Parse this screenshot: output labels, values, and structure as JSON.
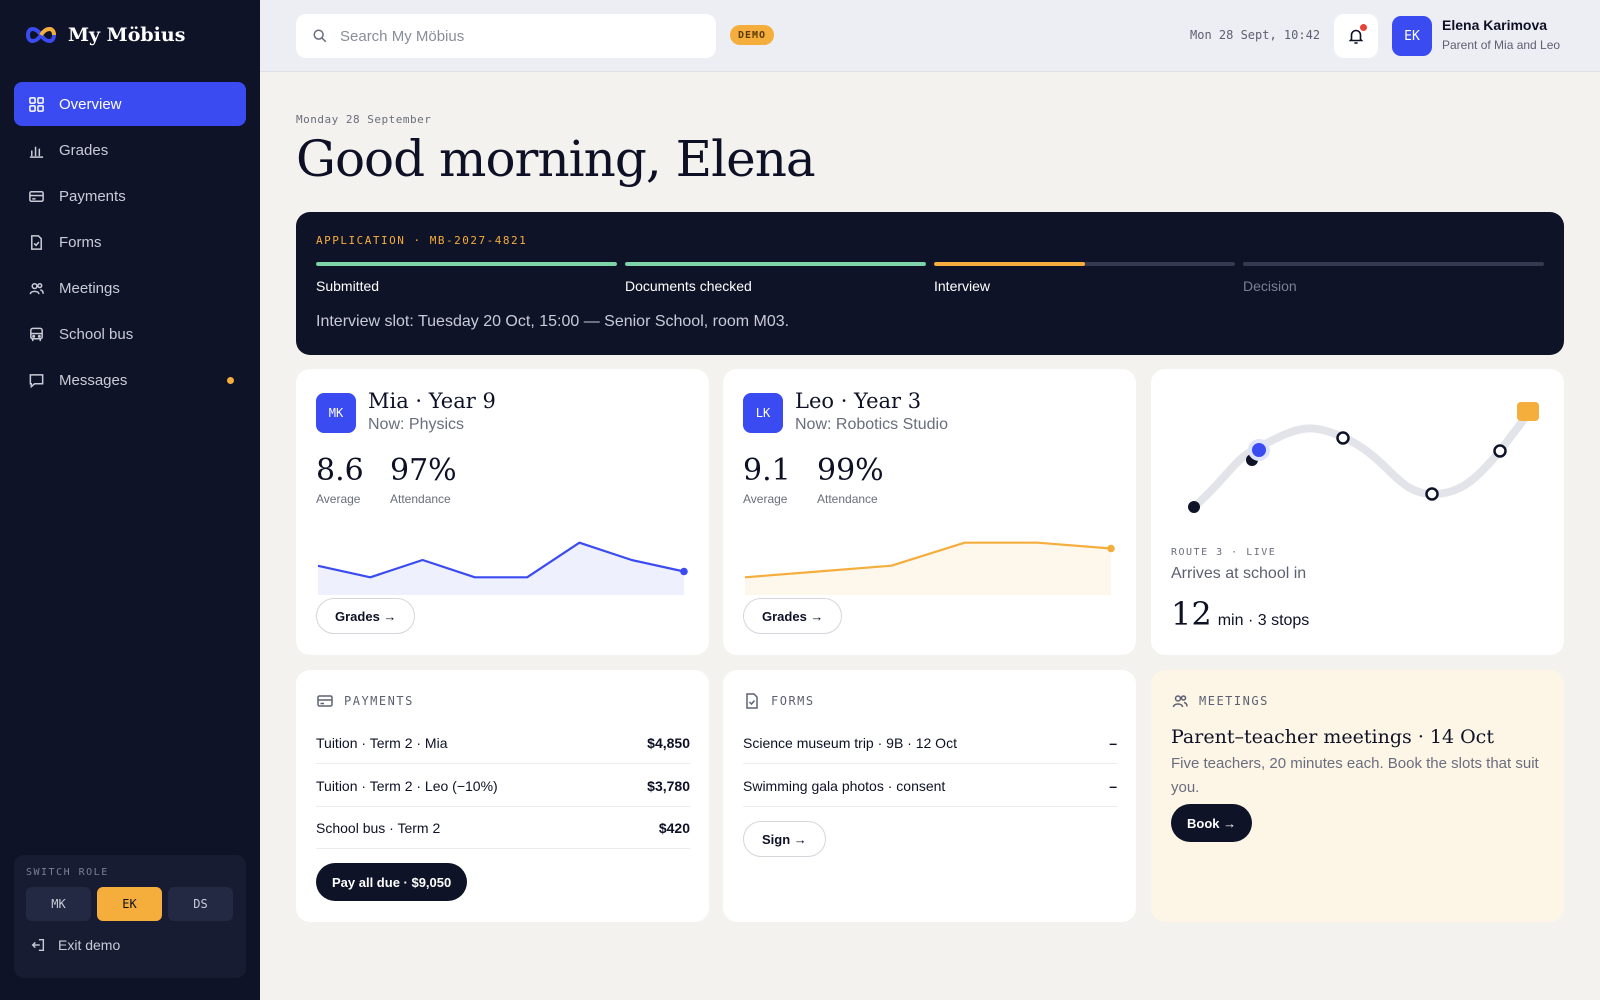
{
  "brand": {
    "name": "My Möbius"
  },
  "sidebar": {
    "items": [
      {
        "label": "Overview",
        "icon": "grid-icon",
        "active": true
      },
      {
        "label": "Grades",
        "icon": "bar-chart-icon"
      },
      {
        "label": "Payments",
        "icon": "card-icon"
      },
      {
        "label": "Forms",
        "icon": "document-check-icon"
      },
      {
        "label": "Meetings",
        "icon": "users-icon"
      },
      {
        "label": "School bus",
        "icon": "bus-icon"
      },
      {
        "label": "Messages",
        "icon": "chat-icon",
        "unread": true
      }
    ],
    "switch_role": {
      "title": "SWITCH ROLE",
      "roles": [
        "MK",
        "EK",
        "DS"
      ],
      "active": "EK"
    },
    "exit_label": "Exit demo"
  },
  "header": {
    "search_placeholder": "Search My Möbius",
    "badge": "DEMO",
    "datetime": "Mon 28 Sept, 10:42",
    "user": {
      "initials": "EK",
      "name": "Elena Karimova",
      "role": "Parent of Mia and Leo"
    }
  },
  "greeting": {
    "date": "Monday 28 September",
    "title": "Good morning, Elena"
  },
  "application": {
    "code": "APPLICATION · MB-2027-4821",
    "steps": [
      {
        "label": "Submitted",
        "progress": 1.0,
        "color": "#7fd3a8"
      },
      {
        "label": "Documents checked",
        "progress": 1.0,
        "color": "#7fd3a8"
      },
      {
        "label": "Interview",
        "progress": 0.5,
        "color": "#f5ad3c"
      },
      {
        "label": "Decision",
        "progress": 0.0,
        "color": "#353a52"
      }
    ],
    "slot": "Interview slot: Tuesday 20 Oct, 15:00 — Senior School, room M03."
  },
  "children": [
    {
      "initials": "MK",
      "name": "Mia · Year 9",
      "now": "Now: Physics",
      "average": "8.6",
      "average_label": "Average",
      "attendance": "97%",
      "attendance_label": "Attendance",
      "button": "Grades →",
      "trend": [
        8.6,
        8.4,
        8.7,
        8.4,
        8.4,
        9.0,
        8.7,
        8.5
      ],
      "color": "#3b4bf2",
      "fill": "#eef0fe"
    },
    {
      "initials": "LK",
      "name": "Leo · Year 3",
      "now": "Now: Robotics Studio",
      "average": "9.1",
      "average_label": "Average",
      "attendance": "99%",
      "attendance_label": "Attendance",
      "button": "Grades →",
      "trend": [
        8.6,
        8.7,
        8.8,
        9.2,
        9.2,
        9.1
      ],
      "color": "#f5ad3c",
      "fill": "#fef8ec"
    }
  ],
  "bus": {
    "meta": "ROUTE 3 · LIVE",
    "arrives": "Arrives at school in",
    "minutes": "12",
    "unit": "min · 3 stops"
  },
  "payments": {
    "title": "PAYMENTS",
    "rows": [
      {
        "label": "Tuition · Term 2 · Mia",
        "amount": "$4,850"
      },
      {
        "label": "Tuition · Term 2 · Leo (−10%)",
        "amount": "$3,780"
      },
      {
        "label": "School bus · Term 2",
        "amount": "$420"
      }
    ],
    "button": "Pay all due · $9,050"
  },
  "forms": {
    "title": "FORMS",
    "rows": [
      {
        "label": "Science museum trip · 9B · 12 Oct",
        "status": "–"
      },
      {
        "label": "Swimming gala photos · consent",
        "status": "–"
      }
    ],
    "button": "Sign →"
  },
  "meetings": {
    "title": "MEETINGS",
    "headline": "Parent–teacher meetings · 14 Oct",
    "description": "Five teachers, 20 minutes each. Book the slots that suit you.",
    "button": "Book →"
  }
}
